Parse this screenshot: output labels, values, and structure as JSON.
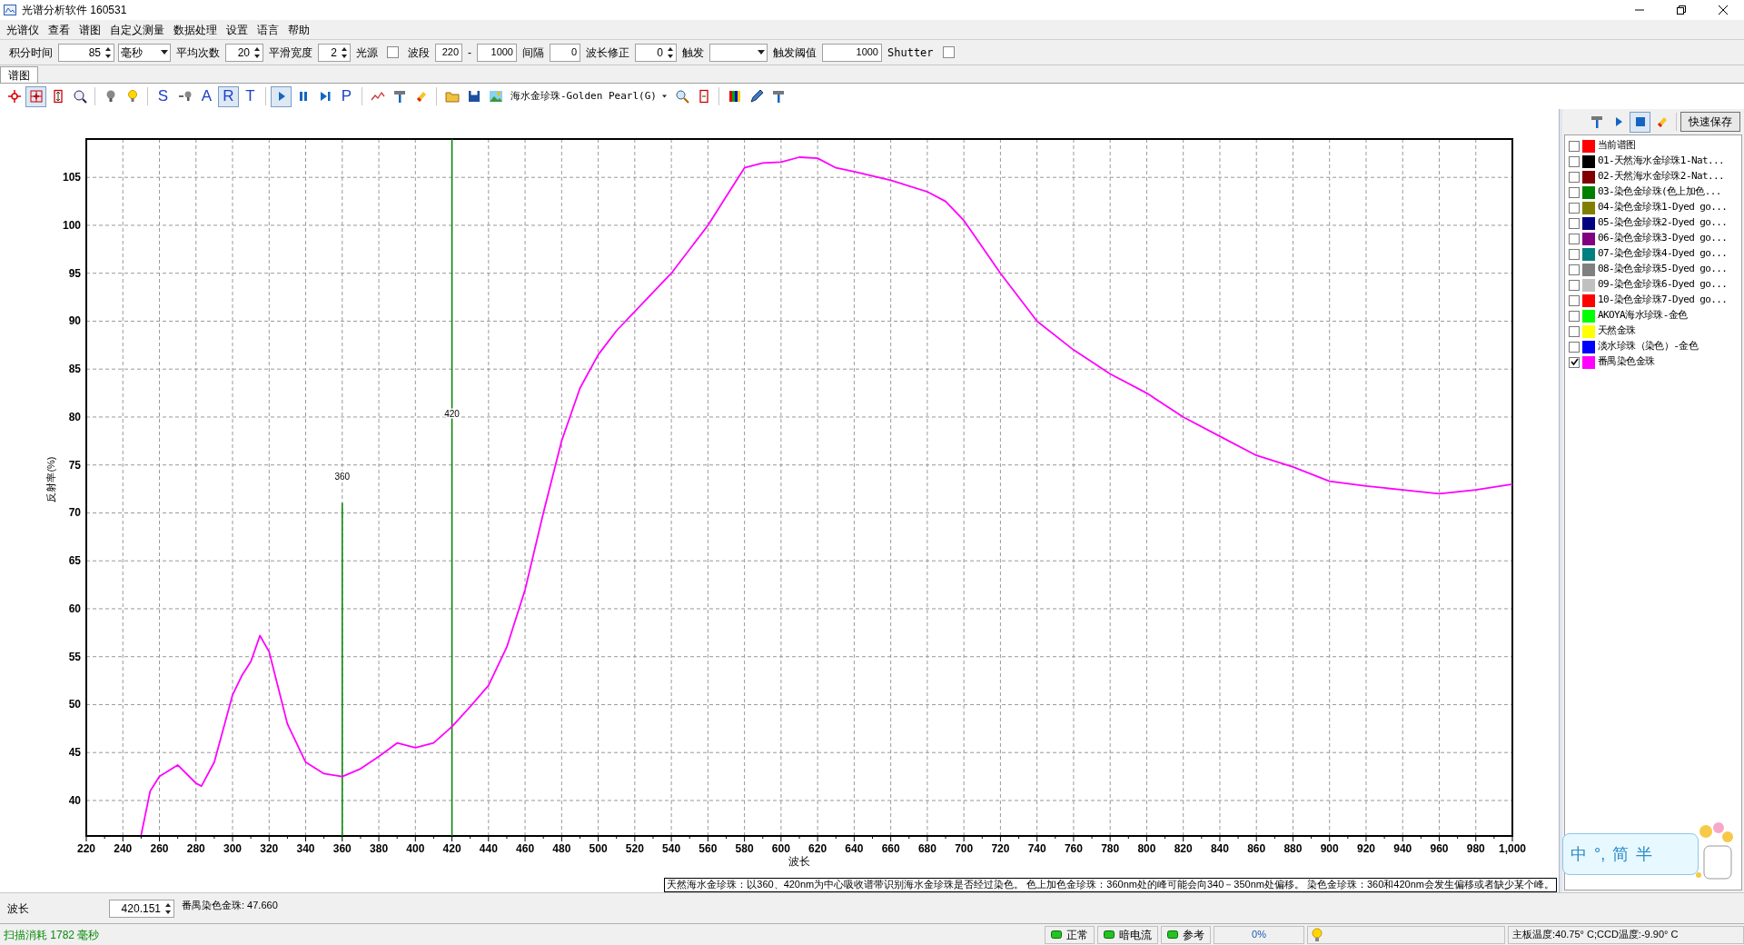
{
  "window": {
    "title": "光谱分析软件 160531"
  },
  "menu": [
    "光谱仪",
    "查看",
    "谱图",
    "自定义测量",
    "数据处理",
    "设置",
    "语言",
    "帮助"
  ],
  "params": [
    {
      "kind": "label",
      "text": "积分时间"
    },
    {
      "kind": "spin",
      "value": "85"
    },
    {
      "kind": "select",
      "value": "毫秒"
    },
    {
      "kind": "label",
      "text": "平均次数"
    },
    {
      "kind": "spin",
      "value": "20"
    },
    {
      "kind": "label",
      "text": "平滑宽度"
    },
    {
      "kind": "spin",
      "value": "2"
    },
    {
      "kind": "label",
      "text": "光源"
    },
    {
      "kind": "checkbox",
      "checked": false
    },
    {
      "kind": "label",
      "text": "波段"
    },
    {
      "kind": "field",
      "value": "220"
    },
    {
      "kind": "label",
      "text": "-"
    },
    {
      "kind": "field",
      "value": "1000"
    },
    {
      "kind": "label",
      "text": "间隔"
    },
    {
      "kind": "field",
      "value": "0"
    },
    {
      "kind": "label",
      "text": "波长修正"
    },
    {
      "kind": "spin",
      "value": "0"
    },
    {
      "kind": "label",
      "text": "触发"
    },
    {
      "kind": "select"
    },
    {
      "kind": "label",
      "text": "触发阈值"
    },
    {
      "kind": "field",
      "value": "1000"
    },
    {
      "kind": "label",
      "text": "Shutter"
    },
    {
      "kind": "checkbox",
      "checked": false
    }
  ],
  "tabs": [
    {
      "label": "谱图",
      "selected": true
    }
  ],
  "toolbar": [
    {
      "kind": "icon",
      "selected": false
    },
    {
      "kind": "icon",
      "selected": true
    },
    {
      "kind": "icon",
      "selected": false
    },
    {
      "kind": "icon",
      "selected": false
    },
    {
      "kind": "sep"
    },
    {
      "kind": "icon",
      "selected": false
    },
    {
      "kind": "icon",
      "selected": false
    },
    {
      "kind": "sep"
    },
    {
      "kind": "letter",
      "label": "S",
      "selected": false
    },
    {
      "kind": "icon",
      "selected": false
    },
    {
      "kind": "letter",
      "label": "A",
      "selected": false
    },
    {
      "kind": "letter",
      "label": "R",
      "selected": true
    },
    {
      "kind": "letter",
      "label": "T",
      "selected": false
    },
    {
      "kind": "sep"
    },
    {
      "kind": "icon",
      "selected": true
    },
    {
      "kind": "icon",
      "selected": false
    },
    {
      "kind": "icon",
      "selected": false
    },
    {
      "kind": "letter",
      "label": "P",
      "selected": false
    },
    {
      "kind": "sep"
    },
    {
      "kind": "icon",
      "selected": false
    },
    {
      "kind": "icon",
      "selected": false
    },
    {
      "kind": "icon",
      "selected": false
    },
    {
      "kind": "sep"
    },
    {
      "kind": "icon",
      "selected": false
    },
    {
      "kind": "icon",
      "selected": false
    },
    {
      "kind": "icon",
      "selected": false
    },
    {
      "kind": "combo",
      "value": "海水金珍珠-Golden Pearl(G)"
    },
    {
      "kind": "icon",
      "selected": false
    },
    {
      "kind": "icon",
      "selected": false
    },
    {
      "kind": "sep"
    },
    {
      "kind": "icon",
      "selected": false
    },
    {
      "kind": "icon",
      "selected": false
    },
    {
      "kind": "icon",
      "selected": false
    }
  ],
  "chart": {
    "chart_data": {
      "type": "line",
      "xlabel": "波长",
      "ylabel": "反射率(%)",
      "xlim": [
        220,
        1000
      ],
      "ylim": [
        36.3,
        109
      ],
      "xticks": [
        220,
        240,
        260,
        280,
        300,
        320,
        340,
        360,
        380,
        400,
        420,
        440,
        460,
        480,
        500,
        520,
        540,
        560,
        580,
        600,
        620,
        640,
        660,
        680,
        700,
        720,
        740,
        760,
        780,
        800,
        820,
        840,
        860,
        880,
        900,
        920,
        940,
        960,
        980,
        {
          "value": 1000,
          "label": "1,000"
        }
      ],
      "yticks": [
        40,
        45,
        50,
        55,
        60,
        65,
        70,
        75,
        80,
        85,
        90,
        95,
        100,
        105
      ],
      "x": [
        250,
        255,
        260,
        270,
        280,
        283,
        290,
        300,
        305,
        310,
        315,
        320,
        330,
        340,
        350,
        360,
        370,
        380,
        390,
        400,
        410,
        420,
        430,
        440,
        450,
        460,
        470,
        480,
        490,
        500,
        510,
        520,
        540,
        560,
        570,
        580,
        590,
        600,
        610,
        620,
        630,
        640,
        660,
        680,
        690,
        700,
        720,
        740,
        760,
        780,
        800,
        820,
        840,
        860,
        880,
        900,
        920,
        940,
        960,
        980,
        1000
      ],
      "grid": true,
      "series": [
        {
          "color": "#ff00ff",
          "values": [
            36.4,
            41,
            42.5,
            43.7,
            41.8,
            41.5,
            44,
            51,
            53,
            54.5,
            57.2,
            55.5,
            48,
            44,
            42.8,
            42.5,
            43.3,
            44.6,
            46,
            45.5,
            46,
            47.7,
            49.8,
            52,
            56,
            62,
            70,
            77.5,
            83,
            86.5,
            89,
            91,
            95,
            100,
            103,
            106,
            106.5,
            106.6,
            107.1,
            107,
            106,
            105.6,
            104.7,
            103.5,
            102.5,
            100.5,
            95,
            90,
            87,
            84.5,
            82.5,
            80,
            78,
            76,
            74.8,
            73.3,
            72.8,
            72.4,
            72,
            72.4,
            73
          ]
        }
      ],
      "ref_lines": [
        {
          "axis": "x",
          "value": 360,
          "color": "#008000",
          "label": "360"
        },
        {
          "axis": "x",
          "value": 420,
          "color": "#008000",
          "label": "420"
        }
      ]
    },
    "note": "天然海水金珍珠：以360、420nm为中心吸收谱带识别海水金珍珠是否经过染色。 色上加色金珍珠：360nm处的峰可能会向340－350nm处偏移。 染色金珍珠：360和420nm会发生偏移或者缺少某个峰。"
  },
  "panel_toolbar": [
    {
      "kind": "icon",
      "selected": false
    },
    {
      "kind": "icon",
      "selected": false
    },
    {
      "kind": "icon",
      "selected": true
    },
    {
      "kind": "icon",
      "selected": false
    },
    {
      "kind": "sep"
    },
    {
      "kind": "button",
      "label": "快速保存"
    }
  ],
  "legend": [
    {
      "label": "当前谱图",
      "color": "#ff0000",
      "checked": false
    },
    {
      "label": "01-天然海水金珍珠1-Nat...",
      "color": "#000000",
      "checked": false
    },
    {
      "label": "02-天然海水金珍珠2-Nat...",
      "color": "#800000",
      "checked": false
    },
    {
      "label": "03-染色金珍珠(色上加色...",
      "color": "#008000",
      "checked": false
    },
    {
      "label": "04-染色金珍珠1-Dyed go...",
      "color": "#808000",
      "checked": false
    },
    {
      "label": "05-染色金珍珠2-Dyed go...",
      "color": "#000080",
      "checked": false
    },
    {
      "label": "06-染色金珍珠3-Dyed go...",
      "color": "#800080",
      "checked": false
    },
    {
      "label": "07-染色金珍珠4-Dyed go...",
      "color": "#008080",
      "checked": false
    },
    {
      "label": "08-染色金珍珠5-Dyed go...",
      "color": "#808080",
      "checked": false
    },
    {
      "label": "09-染色金珍珠6-Dyed go...",
      "color": "#c0c0c0",
      "checked": false
    },
    {
      "label": "10-染色金珍珠7-Dyed go...",
      "color": "#ff0000",
      "checked": false
    },
    {
      "label": "AKOYA海水珍珠-金色",
      "color": "#00ff00",
      "checked": false
    },
    {
      "label": "天然金珠",
      "color": "#ffff00",
      "checked": false
    },
    {
      "label": "淡水珍珠（染色）-金色",
      "color": "#0000ff",
      "checked": false
    },
    {
      "label": "番禺染色金珠",
      "color": "#ff00ff",
      "checked": true
    }
  ],
  "readout": {
    "label": "波长",
    "value": "420.151",
    "reading": "番禺染色金珠: 47.660"
  },
  "ime": [
    "中",
    "°,",
    "简",
    "半"
  ],
  "status_bar": {
    "scan": "扫描消耗 1782 毫秒",
    "indicators": [
      {
        "label": "正常"
      },
      {
        "label": "暗电流"
      },
      {
        "label": "参考"
      }
    ],
    "progress": "0%",
    "temperature": "主板温度:40.75° C;CCD温度:-9.90° C"
  }
}
